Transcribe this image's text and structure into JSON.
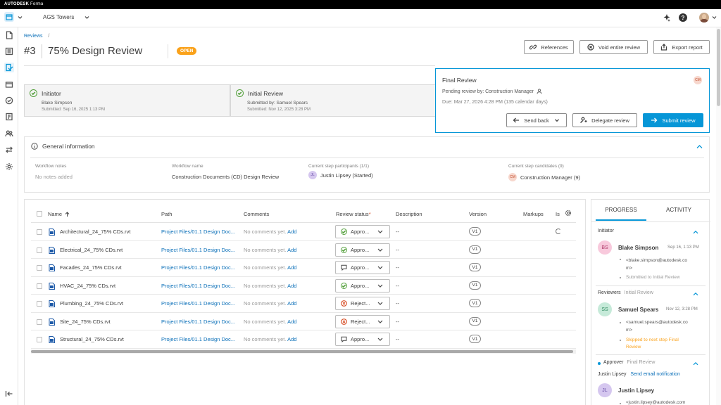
{
  "topbar": {
    "brand_bold": "AUTODESK",
    "brand_rest": "Forma"
  },
  "appbar": {
    "project": "AGS Towers",
    "user_initial": "?"
  },
  "breadcrumb": {
    "parent": "Reviews",
    "sep": "/"
  },
  "header": {
    "number": "#3",
    "title": "75% Design Review",
    "status": "OPEN"
  },
  "actions": {
    "references": "References",
    "void": "Void entire review",
    "export": "Export report"
  },
  "steps": [
    {
      "title": "Initiator",
      "person": "Blake Simpson",
      "date": "Submitted: Sep 16, 2025 1:13 PM"
    },
    {
      "title": "Initial Review",
      "person": "Submitted by: Samuel Spears",
      "date": "Submitted: Nov 12, 2025 3:28 PM"
    }
  ],
  "final": {
    "title": "Final Review",
    "badge": "CM",
    "pending": "Pending review by: Construction Manager",
    "due": "Due:  Mar 27, 2026 4:28 PM (135 calendar days)",
    "send_back": "Send back",
    "delegate": "Delegate review",
    "submit": "Submit review"
  },
  "general": {
    "title": "General information",
    "notes_label": "Workflow notes",
    "notes_value": "No notes added",
    "wf_label": "Workflow name",
    "wf_value": "Construction Documents (CD) Design Review",
    "participants_label": "Current step participants (1/1)",
    "participant_initials": "JL",
    "participant_name": "Justin Lipsey (Started)",
    "candidates_label": "Current step candidates (9)",
    "candidate_initials": "CM",
    "candidate_name": "Construction Manager (9)"
  },
  "table": {
    "headers": {
      "name": "Name",
      "path": "Path",
      "comments": "Comments",
      "status": "Review status",
      "required": "*",
      "description": "Description",
      "version": "Version",
      "markups": "Markups",
      "issues": "Is"
    },
    "rows": [
      {
        "name": "Architectural_24_75% CDs.rvt",
        "path": "Project Files/01.1 Design Doc...",
        "comment": "No comments yet.",
        "add": "Add",
        "status": "Appro...",
        "status_kind": "approved",
        "desc": "--",
        "version": "V1"
      },
      {
        "name": "Electrical_24_75% CDs.rvt",
        "path": "Project Files/01.1 Design Doc...",
        "comment": "No comments yet.",
        "add": "Add",
        "status": "Appro...",
        "status_kind": "approved",
        "desc": "--",
        "version": "V1"
      },
      {
        "name": "Facades_24_75% CDs.rvt",
        "path": "Project Files/01.1 Design Doc...",
        "comment": "No comments yet.",
        "add": "Add",
        "status": "Appro...",
        "status_kind": "comment",
        "desc": "--",
        "version": "V1"
      },
      {
        "name": "HVAC_24_75% CDs.rvt",
        "path": "Project Files/01.1 Design Doc...",
        "comment": "No comments yet.",
        "add": "Add",
        "status": "Appro...",
        "status_kind": "approved",
        "desc": "--",
        "version": "V1"
      },
      {
        "name": "Plumbing_24_75% CDs.rvt",
        "path": "Project Files/01.1 Design Doc...",
        "comment": "No comments yet.",
        "add": "Add",
        "status": "Reject...",
        "status_kind": "rejected",
        "desc": "--",
        "version": "V1"
      },
      {
        "name": "Site_24_75% CDs.rvt",
        "path": "Project Files/01.1 Design Doc...",
        "comment": "No comments yet.",
        "add": "Add",
        "status": "Reject...",
        "status_kind": "rejected",
        "desc": "--",
        "version": "V1"
      },
      {
        "name": "Structural_24_75% CDs.rvt",
        "path": "Project Files/01.1 Design Doc...",
        "comment": "No comments yet.",
        "add": "Add",
        "status": "Appro...",
        "status_kind": "comment",
        "desc": "--",
        "version": "V1"
      }
    ]
  },
  "panel": {
    "tab_progress": "PROGRESS",
    "tab_activity": "ACTIVITY",
    "initiator_label": "Initiator",
    "p1_initials": "BS",
    "p1_name": "Blake Simpson",
    "p1_date": "Sep 16, 1:13 PM",
    "p1_email": "<blake.simpson@autodesk.co",
    "p1_email2": "m>",
    "p1_note": "Submitted to Initial Review",
    "reviewers_label": "Reviewers",
    "reviewers_step": "Initial Review",
    "p2_initials": "SS",
    "p2_name": "Samuel Spears",
    "p2_date": "Nov 12, 3:28 PM",
    "p2_email": "<samuel.spears@autodesk.co",
    "p2_email2": "m>",
    "p2_note": "Skipped to next step Final",
    "p2_note2": "Review",
    "approver_label": "Approver",
    "approver_step": "Final Review",
    "approver_name": "Justin Lipsey",
    "send_email": "Send email notification",
    "p3_initials": "JL",
    "p3_name": "Justin Lipsey",
    "p3_email": "<justin.lipsey@autodesk.com"
  },
  "colors": {
    "accent": "#0696d7",
    "open": "#faa21b",
    "approved": "#54a03c",
    "rejected": "#d74e26",
    "link": "#0a6fb8"
  }
}
